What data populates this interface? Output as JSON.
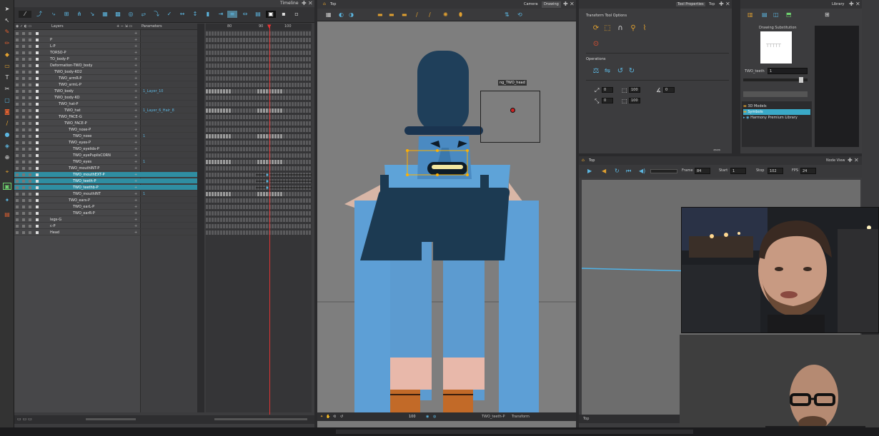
{
  "timeline": {
    "title": "Timeline",
    "col_layers": "Layers",
    "col_params": "Parameters",
    "ruler_ticks": [
      "80",
      "90",
      "100"
    ],
    "layers": [
      {
        "name": "",
        "indent": 0,
        "sel": false,
        "param": ""
      },
      {
        "name": "P",
        "indent": 0,
        "sel": false,
        "param": ""
      },
      {
        "name": "L-P",
        "indent": 0,
        "sel": false,
        "param": ""
      },
      {
        "name": "TORSO-P",
        "indent": 0,
        "sel": false,
        "param": ""
      },
      {
        "name": "TO_body-P",
        "indent": 0,
        "sel": false,
        "param": ""
      },
      {
        "name": "Deformation-TWO_body",
        "indent": 0,
        "sel": false,
        "param": ""
      },
      {
        "name": "TWO_body-KO2",
        "indent": 6,
        "sel": false,
        "param": ""
      },
      {
        "name": "TWO_armR-P",
        "indent": 12,
        "sel": false,
        "param": ""
      },
      {
        "name": "TWO_armL-P",
        "indent": 12,
        "sel": false,
        "param": ""
      },
      {
        "name": "TWO_body",
        "indent": 6,
        "sel": false,
        "param": "1_Layer_10"
      },
      {
        "name": "TWO_body-KO",
        "indent": 6,
        "sel": false,
        "param": ""
      },
      {
        "name": "TWO_hat-P",
        "indent": 12,
        "sel": false,
        "param": ""
      },
      {
        "name": "TWO_hat",
        "indent": 20,
        "sel": false,
        "param": "1_Layer_6_Hair_8"
      },
      {
        "name": "TWO_FACE-G",
        "indent": 12,
        "sel": false,
        "param": ""
      },
      {
        "name": "TWO_FACE-P",
        "indent": 20,
        "sel": false,
        "param": ""
      },
      {
        "name": "TWO_nose-P",
        "indent": 26,
        "sel": false,
        "param": ""
      },
      {
        "name": "TWO_nose",
        "indent": 32,
        "sel": false,
        "param": "1"
      },
      {
        "name": "TWO_eyes-P",
        "indent": 26,
        "sel": false,
        "param": ""
      },
      {
        "name": "TWO_eyelids-P",
        "indent": 32,
        "sel": false,
        "param": ""
      },
      {
        "name": "TWO_eyePupilsCORN",
        "indent": 32,
        "sel": false,
        "param": ""
      },
      {
        "name": "TWO_eyes",
        "indent": 32,
        "sel": false,
        "param": "1"
      },
      {
        "name": "TWO_mouthINT-P",
        "indent": 26,
        "sel": false,
        "param": ""
      },
      {
        "name": "TWO_mouthEXT-P",
        "indent": 32,
        "sel": true,
        "param": ""
      },
      {
        "name": "TWO_teeth-P",
        "indent": 32,
        "sel": true,
        "param": ""
      },
      {
        "name": "TWO_teethb-P",
        "indent": 32,
        "sel": true,
        "param": ""
      },
      {
        "name": "TWO_mouthINT",
        "indent": 32,
        "sel": false,
        "param": "1"
      },
      {
        "name": "TWO_ears-P",
        "indent": 26,
        "sel": false,
        "param": ""
      },
      {
        "name": "TWO_earL-P",
        "indent": 32,
        "sel": false,
        "param": ""
      },
      {
        "name": "TWO_earR-P",
        "indent": 32,
        "sel": false,
        "param": ""
      },
      {
        "name": "legs-G",
        "indent": 0,
        "sel": false,
        "param": ""
      },
      {
        "name": "c-P",
        "indent": 0,
        "sel": false,
        "param": ""
      },
      {
        "name": "Head",
        "indent": 0,
        "sel": false,
        "param": ""
      }
    ]
  },
  "camera": {
    "view_label": "Top",
    "tab_camera": "Camera",
    "tab_drawing": "Drawing",
    "peg_label": "ng_TWO_head",
    "status_zoom": "100",
    "status_layer": "TWO_teeth-P",
    "status_mode": "Transform"
  },
  "tool_properties": {
    "tab_title": "Tool Properties",
    "tab_top": "Top",
    "section_options": "Transform Tool Options",
    "section_operations": "Operations",
    "field_x": "0",
    "field_y": "0",
    "field_w": "100",
    "field_h": "100",
    "field_angle": "0"
  },
  "library": {
    "title": "Library",
    "drawing_sub": "Drawing Substitution",
    "preview_text": "TTTTT",
    "sub_label": "TWO_teeth",
    "sub_value": "1",
    "tree": [
      "3D Models",
      "Symbols",
      "Harmony Premium Library"
    ]
  },
  "top_view": {
    "title": "Top",
    "node_view": "Node View",
    "frame_label": "Frame",
    "frame_value": "84",
    "start_label": "Start",
    "start_value": "1",
    "stop_label": "Stop",
    "stop_value": "102",
    "fps_label": "FPS",
    "fps_value": "24",
    "status_label": "Top"
  },
  "colors": {
    "accent": "#5cb6e0",
    "selection": "#2f8ea2",
    "playhead": "#dd3333",
    "orange_icon": "#e0a030"
  }
}
